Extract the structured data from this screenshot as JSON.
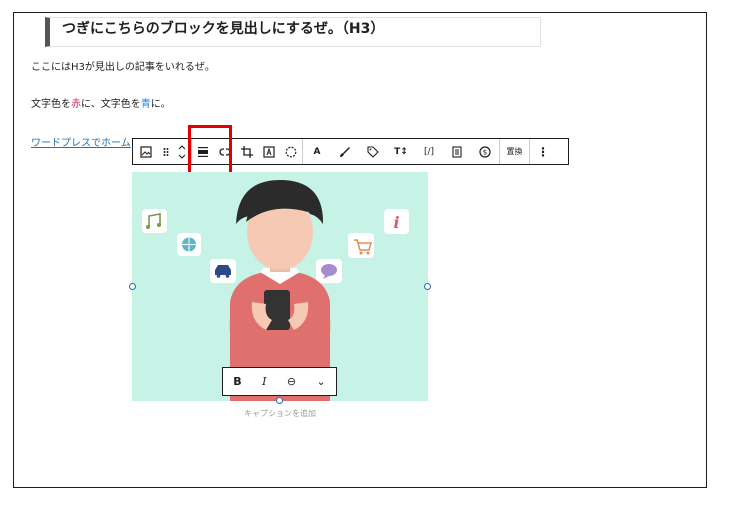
{
  "heading": {
    "text": "つぎにこちらのブロックを見出しにするぜ。（H3）"
  },
  "paragraphs": {
    "p1": "ここにはH3が見出しの記事をいれるぜ。",
    "p2_before": "文字色を",
    "p2_red": "赤",
    "p2_middle": "に、文字色を",
    "p2_blue": "青",
    "p2_after": "に。",
    "p3_link": "ワードプレスでホーム"
  },
  "toolbar": {
    "icons": [
      "image-icon",
      "drag-handle-icon",
      "move-up-down-icon",
      "align-icon",
      "link-icon",
      "crop-icon",
      "text-over-image-icon",
      "select-circle-icon",
      "text-color-icon",
      "highlight-brush-icon",
      "tag-icon",
      "font-size-icon",
      "code-icon",
      "document-icon",
      "coin-icon"
    ],
    "text_color_label": "A",
    "font_size_label": "T↕",
    "code_label": "[/]",
    "replace_label": "置換",
    "more_label": "⋮"
  },
  "format_bar": {
    "bold_label": "B",
    "italic_label": "I",
    "link_label": "⊖",
    "more_label": "⌄"
  },
  "image": {
    "colors": {
      "background": "#c7f3e6",
      "sweater": "#e0706e",
      "hair": "#2b2b2b",
      "skin": "#f5c9b3",
      "phone": "#333333"
    },
    "floating_icons": [
      "music-note-icon",
      "globe-icon",
      "car-icon",
      "shopping-cart-icon",
      "chat-bubble-icon",
      "info-icon"
    ]
  },
  "caption": {
    "placeholder": "キャプションを追加"
  },
  "colors": {
    "highlight": "#e00000",
    "link": "#2271b1",
    "selection": "#2271b1"
  }
}
